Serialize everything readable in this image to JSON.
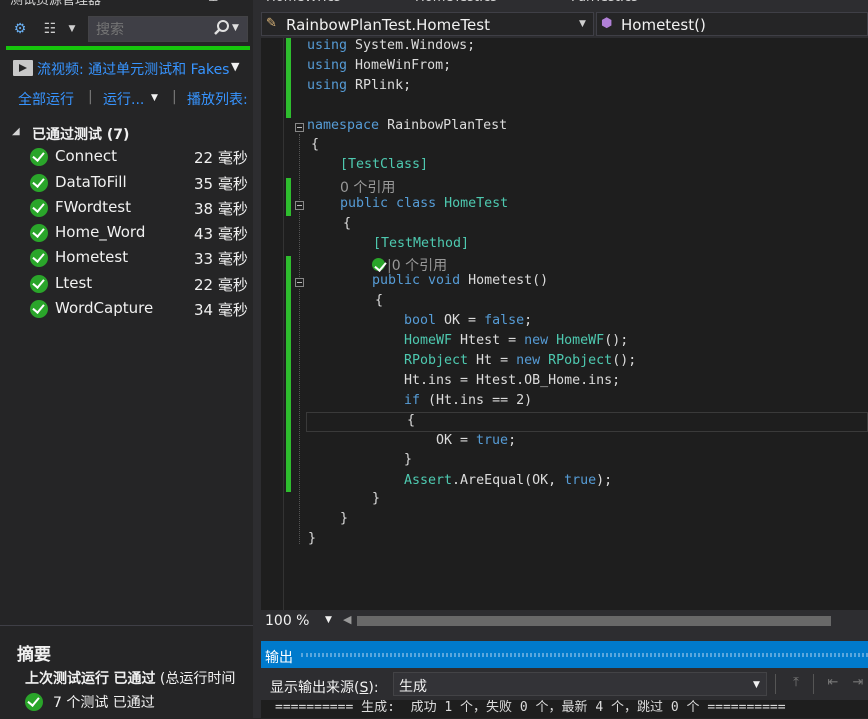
{
  "test_explorer": {
    "title": "测试资源管理器",
    "pin_icon": "pin-icon",
    "close_icon": "close-icon",
    "search": {
      "placeholder": "搜索",
      "value": ""
    },
    "playlist": {
      "label": "流视频: 通过单元测试和 Fakes"
    },
    "run_links": {
      "run_all": "全部运行",
      "separator": "|",
      "run": "运行...",
      "playlist": "播放列表:"
    },
    "group": {
      "title": "已通过测试 (7)"
    },
    "tests": [
      {
        "name": "Connect",
        "time": "22 毫秒"
      },
      {
        "name": "DataToFill",
        "time": "35 毫秒"
      },
      {
        "name": "FWordtest",
        "time": "38 毫秒"
      },
      {
        "name": "Home_Word",
        "time": "43 毫秒"
      },
      {
        "name": "Hometest",
        "time": "33 毫秒"
      },
      {
        "name": "Ltest",
        "time": "22 毫秒"
      },
      {
        "name": "WordCapture",
        "time": "34 毫秒"
      }
    ],
    "summary": {
      "heading": "摘要",
      "last_run_prefix": "上次测试运行",
      "last_run_status": "已通过",
      "last_run_suffix": "(总运行时间",
      "count_text": "7 个测试 已通过"
    }
  },
  "editor": {
    "tabs": [
      "HomeWF.cs",
      "HomeTest.cs",
      "FunTest.cs"
    ],
    "nav_left": "RainbowPlanTest.HomeTest",
    "nav_right": "Hometest()",
    "zoom": "100 %",
    "code": {
      "l1a": "using",
      "l1b": " System.Windows;",
      "l2a": "using",
      "l2b": " HomeWinFrom;",
      "l3a": "using",
      "l3b": " RPlink;",
      "ns_kw": "namespace",
      "ns_name": " RainbowPlanTest",
      "brace_open": "{",
      "brace_close": "}",
      "attr_class": "[TestClass]",
      "refs_class": "0 个引用",
      "pub": "public",
      "cls": " class ",
      "cls_name": "HomeTest",
      "attr_method": "[TestMethod]",
      "refs_method": "0 个引用",
      "void": " void ",
      "method_name": "Hometest()",
      "bool": "bool",
      "bool_rest": " OK = ",
      "false": "false",
      "semi": ";",
      "homewf": "HomeWF",
      "htest_rest": " Htest = ",
      "new": "new",
      "homewf_ctor": " HomeWF",
      "ctor_tail": "();",
      "rpobject": "RPobject",
      "ht_rest": " Ht = ",
      "rpobject_ctor": " RPobject",
      "ht_ins": "Ht.ins = Htest.OB_Home.ins;",
      "if": "if",
      "if_rest": " (Ht.ins == 2)",
      "ok_true_a": "OK = ",
      "true": "true",
      "assert": "Assert",
      "assert_rest": ".AreEqual(OK, ",
      "assert_tail": ");"
    }
  },
  "output": {
    "title": "输出",
    "source_label_pre": "显示输出来源(",
    "source_label_key": "S",
    "source_label_post": "):",
    "source_value": "生成",
    "line": "========== 生成:  成功 1 个，失败 0 个，最新 4 个，跳过 0 个 =========="
  },
  "colors": {
    "accent": "#007acc",
    "pass": "#2aa52a",
    "keyword": "#569cd6",
    "type": "#4ec9b0"
  }
}
